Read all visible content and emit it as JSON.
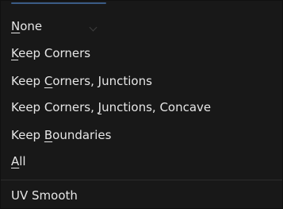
{
  "menu": {
    "items": [
      {
        "prefix": "",
        "underline": "N",
        "suffix": "one"
      },
      {
        "prefix": "",
        "underline": "K",
        "suffix": "eep Corners"
      },
      {
        "prefix": "Keep ",
        "underline": "C",
        "suffix": "orners, Junctions"
      },
      {
        "prefix": "Keep Corners, ",
        "underline": "J",
        "suffix": "unctions, Concave"
      },
      {
        "prefix": "Keep ",
        "underline": "B",
        "suffix": "oundaries"
      },
      {
        "prefix": "",
        "underline": "A",
        "suffix": "ll"
      }
    ],
    "footer_item": "UV Smooth"
  },
  "colors": {
    "background": "#181818",
    "text": "#e6e6e6",
    "separator": "#2c2c2c",
    "accent": "#3b5c86"
  },
  "icons": {
    "background_chevron": "chevron-down-icon"
  }
}
